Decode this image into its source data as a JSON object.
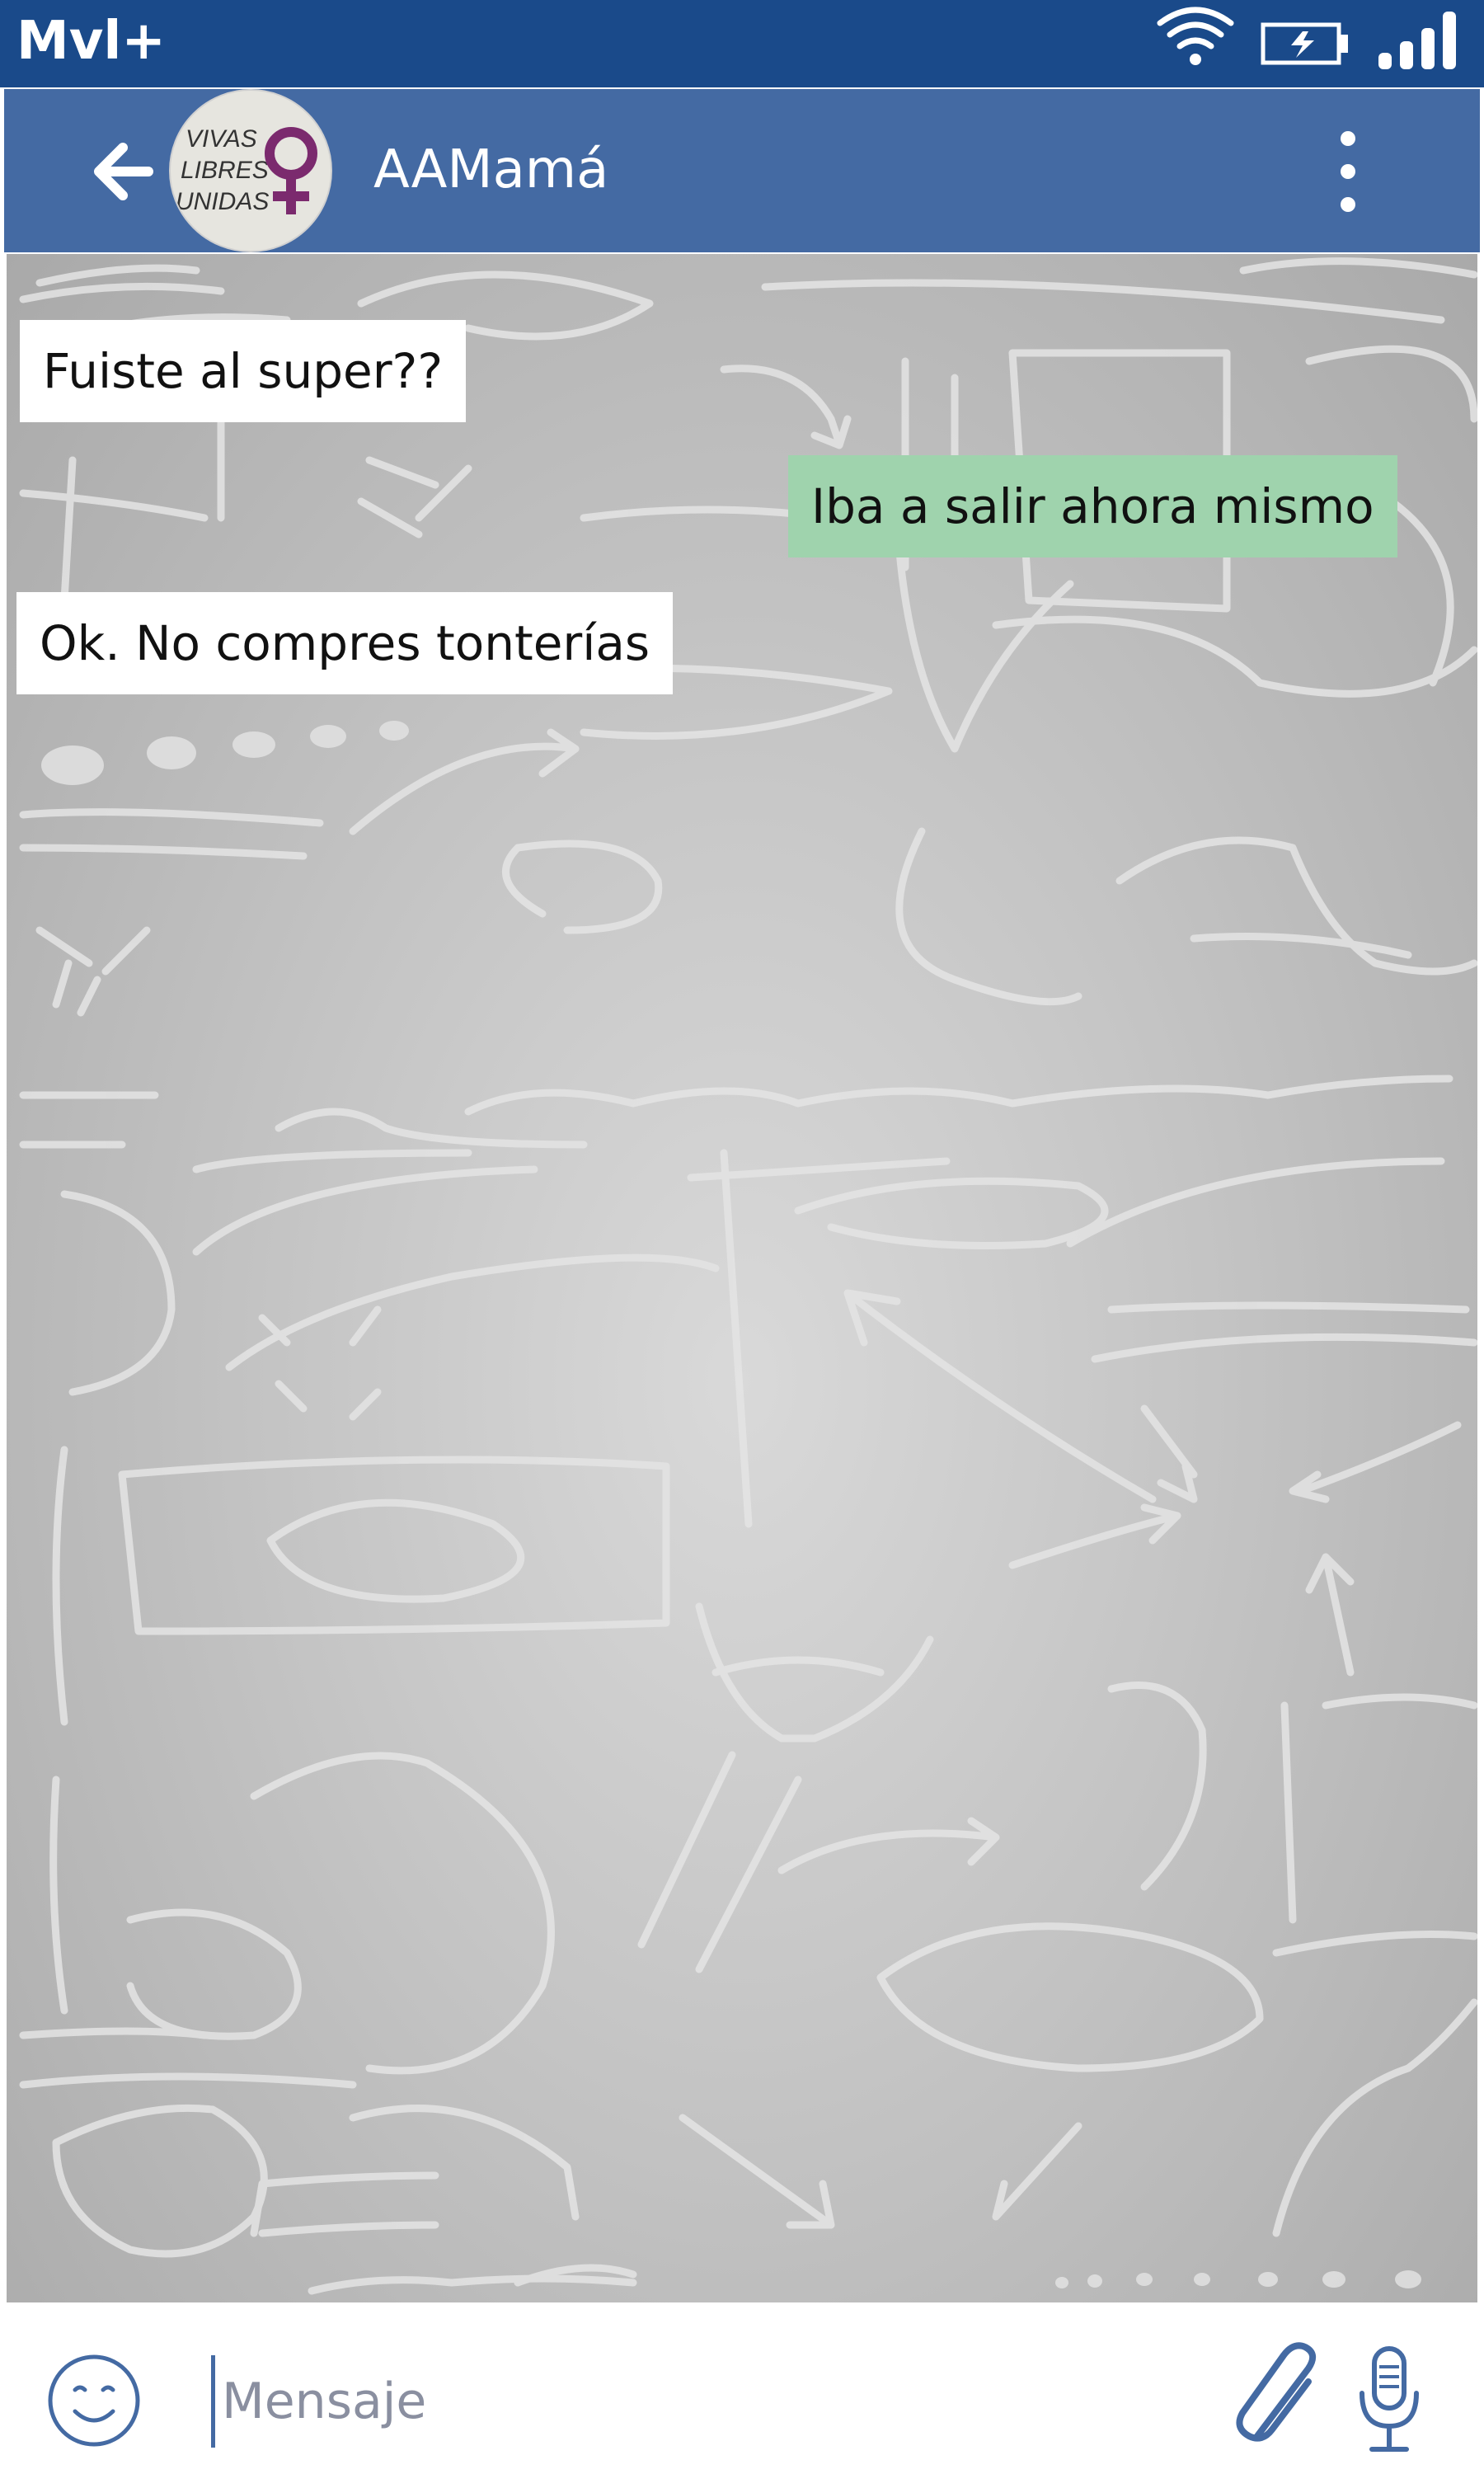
{
  "status_bar": {
    "carrier": "Mvl+",
    "icons": [
      "wifi-icon",
      "battery-charging-icon",
      "signal-icon"
    ]
  },
  "header": {
    "back_icon": "arrow-left-icon",
    "avatar_text": [
      "VIVAS",
      "LIBRES",
      "UNIDAS"
    ],
    "avatar_symbol": "female-symbol",
    "title": "AAMamá",
    "menu_icon": "more-vertical-icon"
  },
  "messages": [
    {
      "direction": "incoming",
      "text": "Fuiste al super??"
    },
    {
      "direction": "outgoing",
      "text": "Iba a salir ahora mismo"
    },
    {
      "direction": "incoming",
      "text": "Ok. No compres tonterías"
    }
  ],
  "composer": {
    "placeholder": "Mensaje",
    "emoji_icon": "smiley-icon",
    "attach_icon": "paperclip-icon",
    "mic_icon": "microphone-icon"
  },
  "colors": {
    "status_bar": "#1a4a8a",
    "app_bar": "#446aa3",
    "incoming_bubble": "#ffffff",
    "outgoing_bubble": "#9fd3ad",
    "icon_blue": "#446aa3",
    "avatar_purple": "#7b2a6e"
  }
}
